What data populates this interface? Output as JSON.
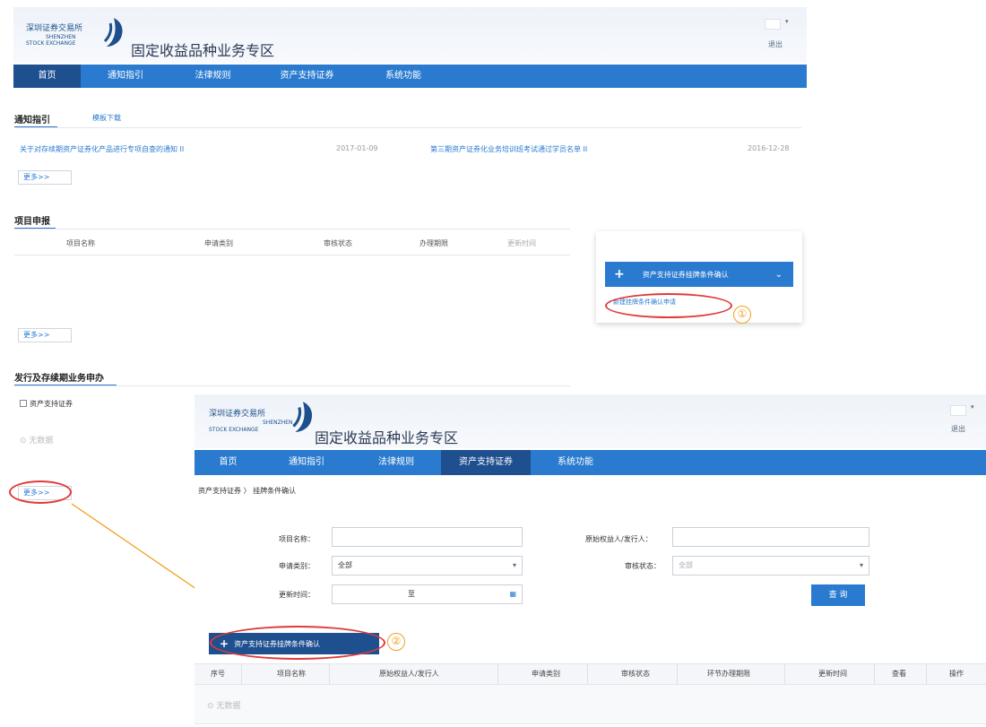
{
  "header": {
    "logo_cn": "深圳证券交易所",
    "logo_en_1": "SHENZHEN",
    "logo_en_2": "STOCK EXCHANGE",
    "zone_title": "固定收益品种业务专区",
    "logout": "退出"
  },
  "nav_top": [
    "首页",
    "通知指引",
    "法律规则",
    "资产支持证券",
    "系统功能"
  ],
  "notice_section": {
    "tab_active": "通知指引",
    "tab_other": "模板下载",
    "items": [
      {
        "title": "关于对存续期资产证券化产品进行专项自查的通知 II",
        "date": "2017-01-09"
      },
      {
        "title": "第三期资产证券化业务培训班考试通过学员名单 II",
        "date": "2016-12-28"
      }
    ],
    "more": "更多>>"
  },
  "project_section": {
    "title": "项目申报",
    "columns": [
      "项目名称",
      "申请类别",
      "审核状态",
      "办理期限",
      "更新时间"
    ],
    "more": "更多>>"
  },
  "dropdown": {
    "button_label": "资产支持证券挂牌条件确认",
    "item_label": "› 新建挂牌条件确认申请",
    "annotation_1": "①"
  },
  "issue_section": {
    "title": "发行及存续期业务申办",
    "checkbox_label": "资产支持证券",
    "nodata": "无数据",
    "more": "更多>>"
  },
  "overlay": {
    "nav": [
      "首页",
      "通知指引",
      "法律规则",
      "资产支持证券",
      "系统功能"
    ],
    "active_nav": 3,
    "breadcrumb": "资产支持证券  〉 挂牌条件确认",
    "form": {
      "project_name_label": "项目名称：",
      "originator_label": "原始权益人/发行人：",
      "apply_type_label": "申请类别：",
      "apply_type_value": "全部",
      "review_status_label": "审核状态：",
      "review_status_value": "全部",
      "update_time_label": "更新时间：",
      "update_time_sep": "至",
      "query_button": "查 询"
    },
    "action_button": "资产支持证券挂牌条件确认",
    "annotation_2": "②",
    "table_columns": [
      "序号",
      "项目名称",
      "原始权益人/发行人",
      "申请类别",
      "审核状态",
      "环节办理期限",
      "更新时间",
      "查看",
      "操作"
    ],
    "nodata": "无数据"
  },
  "colors": {
    "nav_blue": "#2a7bd0",
    "nav_active": "#1e4f8f",
    "annotation_red": "#e03a3a",
    "annotation_orange": "#f0a020"
  }
}
